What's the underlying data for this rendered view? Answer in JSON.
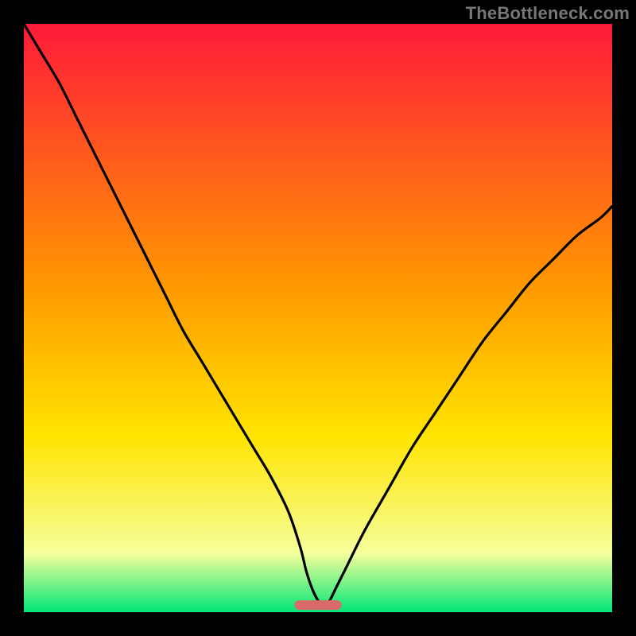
{
  "watermark": "TheBottleneck.com",
  "colors": {
    "frame_bg": "#000000",
    "gradient_top": "#ff1a3a",
    "gradient_mid1": "#ff9a00",
    "gradient_mid2": "#ffe400",
    "gradient_mid3": "#f6ff9c",
    "gradient_bottom": "#00e676",
    "curve": "#000000",
    "marker": "#d96a6a"
  },
  "chart_data": {
    "type": "line",
    "title": "",
    "xlabel": "",
    "ylabel": "",
    "xlim": [
      0,
      100
    ],
    "ylim": [
      0,
      100
    ],
    "x": [
      0,
      3,
      6,
      9,
      12,
      15,
      18,
      21,
      24,
      27,
      30,
      33,
      36,
      39,
      42,
      45,
      47,
      48,
      49,
      50,
      51,
      52,
      53,
      55,
      58,
      62,
      66,
      70,
      74,
      78,
      82,
      86,
      90,
      94,
      98,
      100
    ],
    "values": [
      100,
      95,
      90,
      84,
      78,
      72,
      66,
      60,
      54,
      48,
      43,
      38,
      33,
      28,
      23,
      17,
      11,
      7,
      4,
      2,
      1,
      2,
      4,
      8,
      14,
      21,
      28,
      34,
      40,
      46,
      51,
      56,
      60,
      64,
      67,
      69
    ],
    "marker": {
      "x_start": 46,
      "x_end": 54,
      "y": 1.2
    }
  }
}
